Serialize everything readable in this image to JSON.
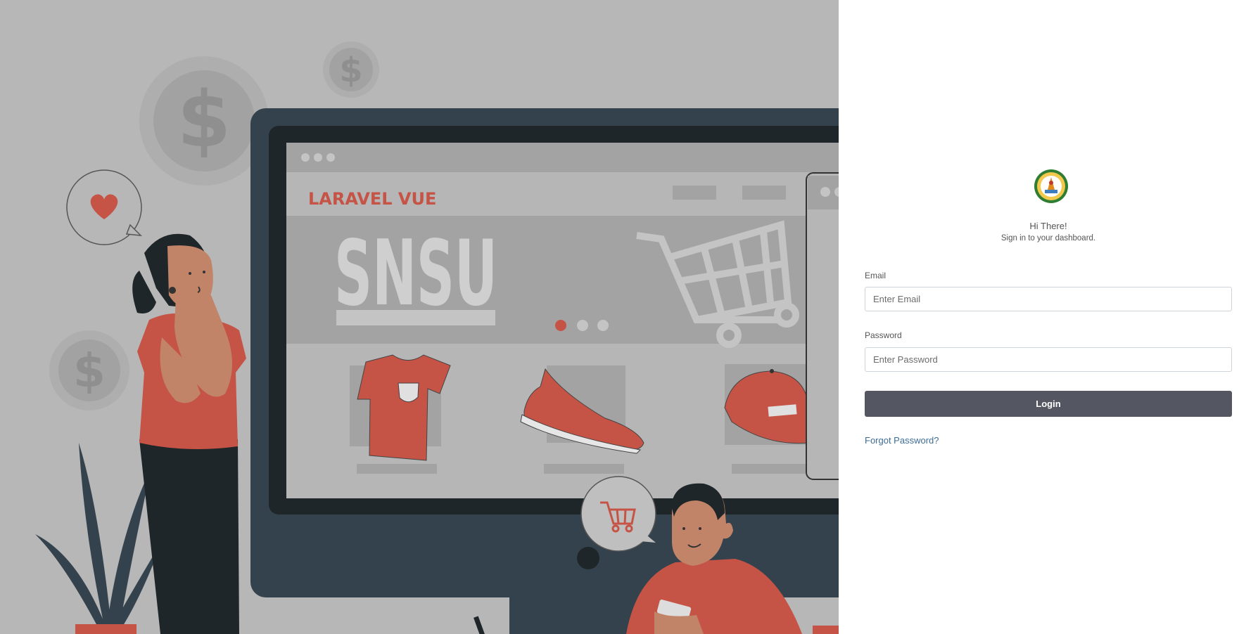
{
  "hero": {
    "brand_text": "LARAVEL VUE",
    "banner_text": "SNSU",
    "accent_color": "#c55446",
    "overlay_color": "#b7b7b7"
  },
  "login": {
    "logo_icon": "university-seal-logo",
    "greeting": "Hi There!",
    "subtitle": "Sign in to your dashboard.",
    "email_label": "Email",
    "email_placeholder": "Enter Email",
    "email_value": "",
    "password_label": "Password",
    "password_placeholder": "Enter Password",
    "password_value": "",
    "login_label": "Login",
    "forgot_label": "Forgot Password?",
    "button_color": "#545762",
    "link_color": "#3d6c96"
  }
}
